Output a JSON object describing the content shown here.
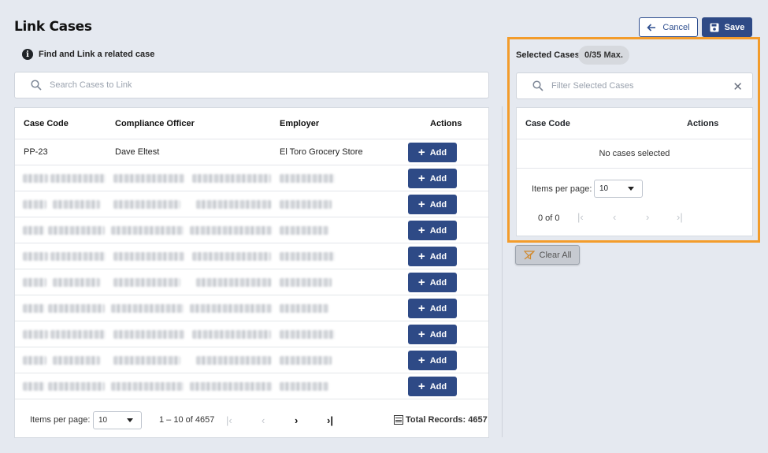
{
  "page": {
    "title": "Link Cases"
  },
  "header": {
    "cancel_label": "Cancel",
    "save_label": "Save"
  },
  "info": {
    "text": "Find and Link a related case"
  },
  "search": {
    "placeholder": "Search Cases to Link"
  },
  "table": {
    "columns": [
      "Case Code",
      "Compliance Officer",
      "Employer",
      "Actions"
    ],
    "first_row": {
      "case_code": "PP-23",
      "officer": "Dave Eltest",
      "employer": "El Toro Grocery Store"
    },
    "add_label": "Add",
    "redacted_rows": 9
  },
  "pager": {
    "items_per_page_label": "Items per page:",
    "items_per_page_value": "10",
    "range": "1 – 10 of 4657",
    "total_label": "Total Records: 4657"
  },
  "selected": {
    "label": "Selected Cases:",
    "badge": "0/35 Max.",
    "filter_placeholder": "Filter Selected Cases",
    "columns": [
      "Case Code",
      "Actions"
    ],
    "empty_text": "No cases selected",
    "items_per_page_label": "Items per page:",
    "items_per_page_value": "10",
    "range": "0 of 0",
    "clear_all_label": "Clear All"
  },
  "colors": {
    "primary": "#2e4a86",
    "highlight": "#f39c2b",
    "background": "#e5e9f0"
  }
}
